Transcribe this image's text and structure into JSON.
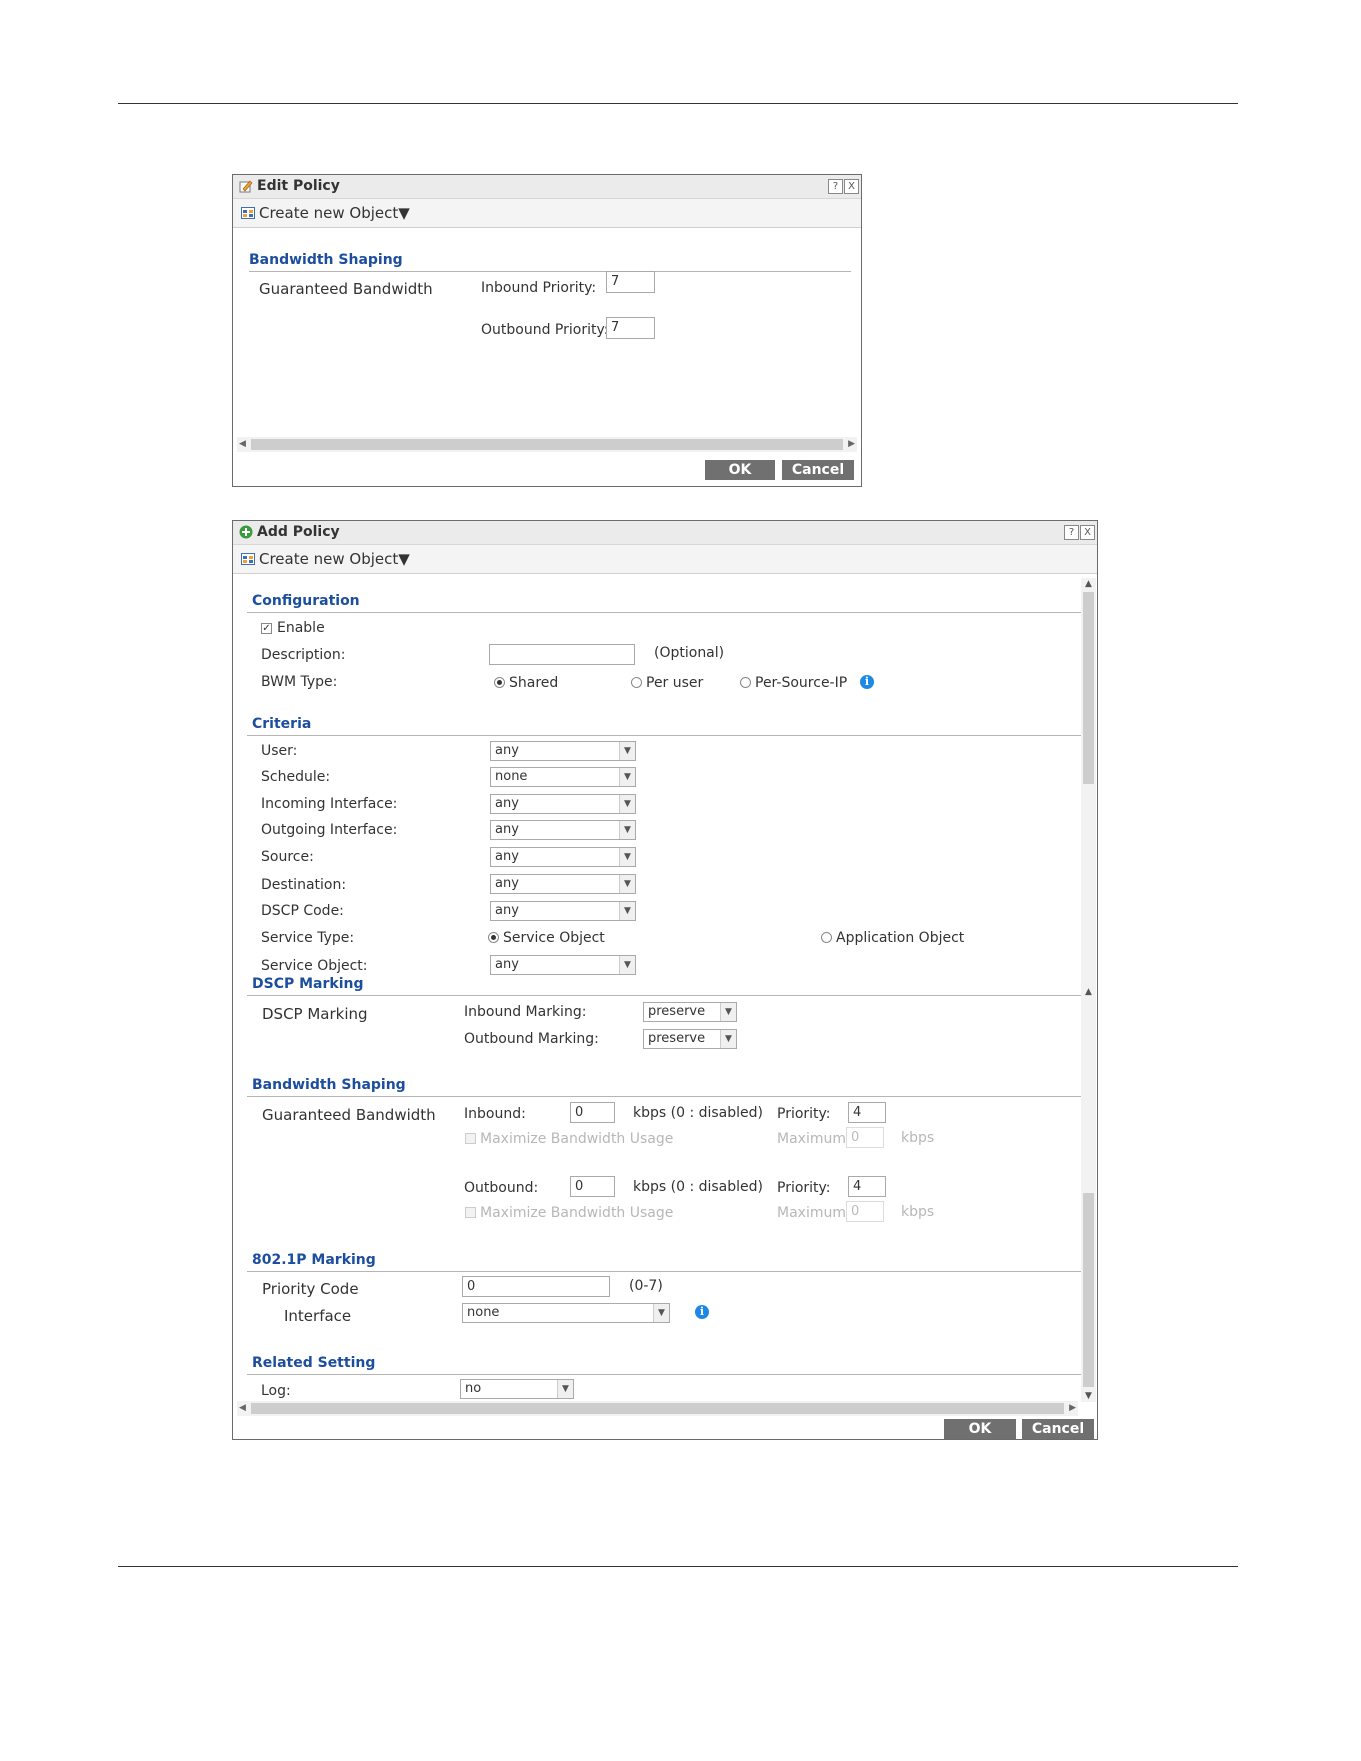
{
  "edit_dialog": {
    "title": "Edit Policy",
    "help": "?",
    "close": "X",
    "create_object": "Create new Object▼",
    "section": "Bandwidth Shaping",
    "guaranteed": "Guaranteed Bandwidth",
    "inbound_priority_label": "Inbound Priority:",
    "inbound_priority_value": "7",
    "outbound_priority_label": "Outbound Priority:",
    "outbound_priority_value": "7",
    "ok": "OK",
    "cancel": "Cancel"
  },
  "add_dialog": {
    "title": "Add Policy",
    "help": "?",
    "close": "X",
    "create_object": "Create new Object▼",
    "configuration": {
      "section": "Configuration",
      "enable_label": "Enable",
      "enable_checked": true,
      "description_label": "Description:",
      "description_value": "",
      "optional": "(Optional)",
      "bwm_type_label": "BWM Type:",
      "bwm_options": [
        "Shared",
        "Per user",
        "Per-Source-IP"
      ],
      "bwm_selected": "Shared"
    },
    "criteria": {
      "section": "Criteria",
      "user_label": "User:",
      "user_value": "any",
      "schedule_label": "Schedule:",
      "schedule_value": "none",
      "incoming_label": "Incoming Interface:",
      "incoming_value": "any",
      "outgoing_label": "Outgoing Interface:",
      "outgoing_value": "any",
      "source_label": "Source:",
      "source_value": "any",
      "destination_label": "Destination:",
      "destination_value": "any",
      "dscp_label": "DSCP Code:",
      "dscp_value": "any",
      "service_type_label": "Service Type:",
      "service_type_options": [
        "Service Object",
        "Application Object"
      ],
      "service_type_selected": "Service Object",
      "service_object_label": "Service Object:",
      "service_object_value": "any"
    },
    "dscp_marking": {
      "section": "DSCP Marking",
      "label": "DSCP Marking",
      "inbound_label": "Inbound Marking:",
      "inbound_value": "preserve",
      "outbound_label": "Outbound Marking:",
      "outbound_value": "preserve"
    },
    "bandwidth_shaping": {
      "section": "Bandwidth Shaping",
      "guaranteed": "Guaranteed Bandwidth",
      "inbound_label": "Inbound:",
      "inbound_value": "0",
      "kbps_disabled": "kbps (0 : disabled)",
      "priority_label": "Priority:",
      "inbound_priority": "4",
      "maximize": "Maximize Bandwidth Usage",
      "maximum_label": "Maximum:",
      "inbound_maximum": "0",
      "kbps": "kbps",
      "outbound_label": "Outbound:",
      "outbound_value": "0",
      "outbound_priority": "4",
      "outbound_maximum": "0"
    },
    "p8021_marking": {
      "section": "802.1P Marking",
      "priority_code_label": "Priority Code",
      "priority_code_value": "0",
      "range": "(0-7)",
      "interface_label": "Interface",
      "interface_value": "none"
    },
    "related": {
      "section": "Related Setting",
      "log_label": "Log:",
      "log_value": "no"
    },
    "ok": "OK",
    "cancel": "Cancel"
  }
}
